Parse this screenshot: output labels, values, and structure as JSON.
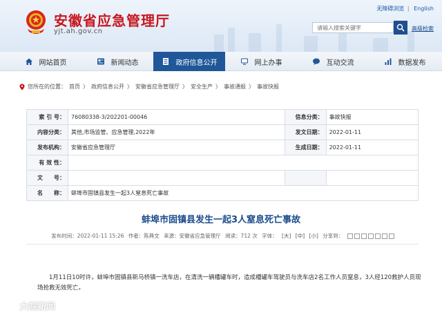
{
  "header": {
    "site_title": "安徽省应急管理厅",
    "site_domain": "yjt.ah.gov.cn",
    "top_links": [
      "无障碍浏览",
      "English"
    ],
    "search_placeholder": "请输入搜索关键字",
    "advanced_search": "高级检索"
  },
  "nav": {
    "items": [
      {
        "label": "网站首页",
        "icon": "home-icon"
      },
      {
        "label": "新闻动态",
        "icon": "news-icon"
      },
      {
        "label": "政府信息公开",
        "icon": "document-icon"
      },
      {
        "label": "网上办事",
        "icon": "monitor-icon"
      },
      {
        "label": "互动交流",
        "icon": "chat-icon"
      },
      {
        "label": "数据发布",
        "icon": "chart-icon"
      }
    ],
    "active_index": 2,
    "active_color": "#1f5798"
  },
  "breadcrumb": {
    "prefix": "您所在的位置：",
    "items": [
      "首页",
      "政府信息公开",
      "安徽省应急管理厅",
      "安全生产",
      "事故通报",
      "事故快报"
    ],
    "separator": "〉"
  },
  "info": {
    "index_label": "索 引 号：",
    "index_value": "76080338-3/202201-00046",
    "category_label": "信息分类：",
    "category_value": "事故快报",
    "topic_label": "内容分类：",
    "topic_value": "其他,市场监管、应急管理,2022年",
    "pubdate_label": "发文日期：",
    "pubdate_value": "2022-01-11",
    "publisher_label": "发布机构：",
    "publisher_value": "安徽省应急管理厅",
    "effective_label": "生成日期：",
    "effective_value": "2022-01-11",
    "validity_label": "有 效 性：",
    "docno_label": "文　　号：",
    "name_label": "名　　称：",
    "name_value": "蚌埠市固镇县发生一起3人窒息死亡事故"
  },
  "article": {
    "title": "蚌埠市固镇县发生一起3人窒息死亡事故",
    "meta_date": "发布时间：2022-01-11 15:26",
    "meta_author": "作者：陈典文",
    "meta_source": "来源：安徽省应急管理厅",
    "meta_views": "阅读：712 次",
    "meta_size_label": "字体：",
    "meta_sizes": [
      "[大]",
      "[中]",
      "[小]"
    ],
    "meta_share_label": "分享到：",
    "body": "1月11日10时许，蚌埠市固镇县新马桥镇一洗车店，在清洗一辆槽罐车时，造成槽罐车驾驶员与洗车店2名工作人员窒息，3人经120救护人员现场抢救无效死亡。"
  },
  "watermark": {
    "text": "大皖新闻"
  },
  "colors": {
    "brand_red": "#c8161d",
    "link_blue": "#1a4b8c",
    "nav_active": "#1f5798"
  }
}
